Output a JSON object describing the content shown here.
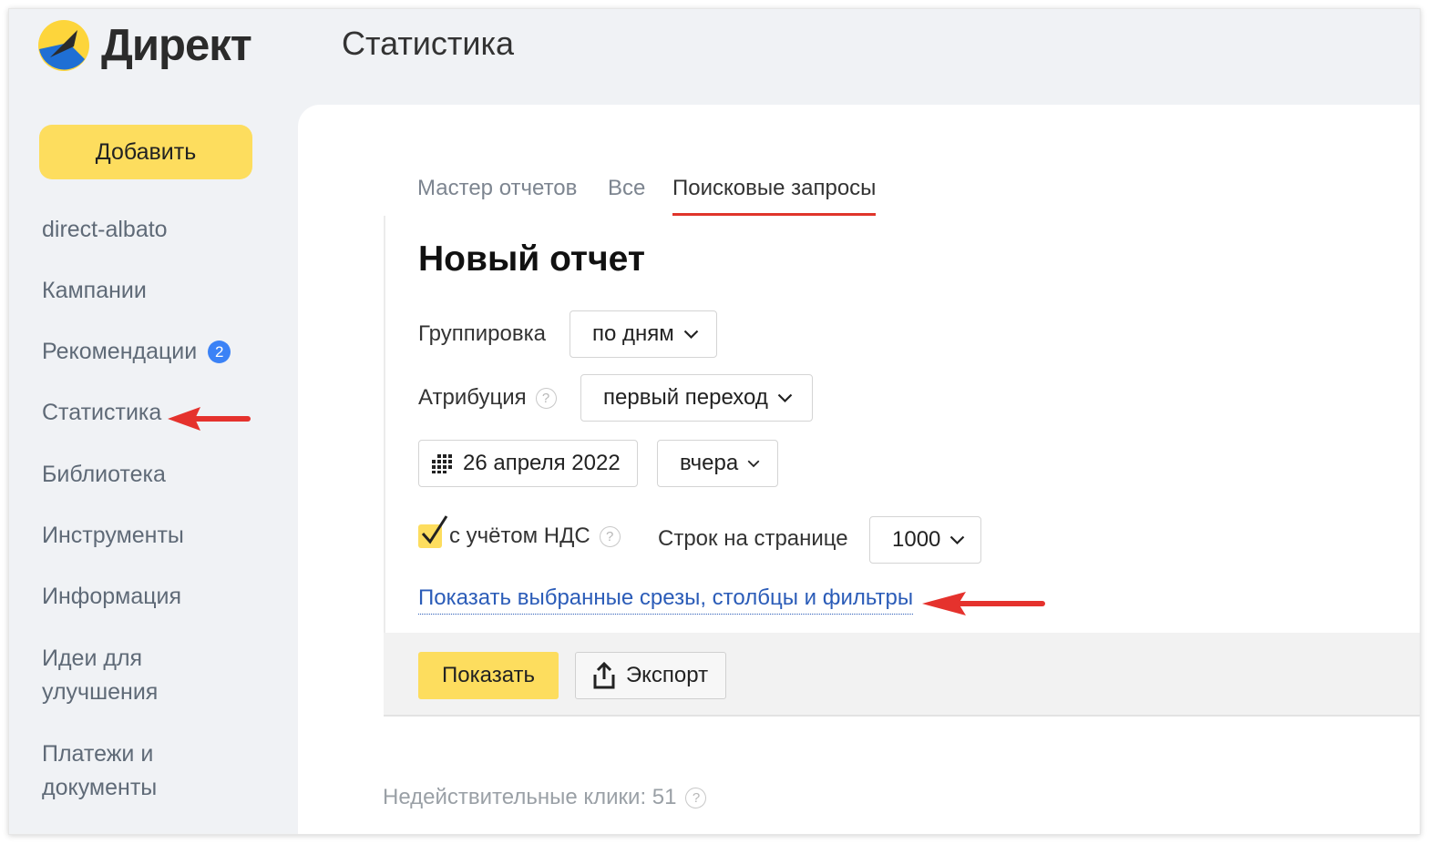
{
  "header": {
    "logo_text": "Директ",
    "page_title": "Статистика"
  },
  "sidebar": {
    "add_button": "Добавить",
    "items": [
      {
        "label": "direct-albato"
      },
      {
        "label": "Кампании"
      },
      {
        "label": "Рекомендации",
        "badge": "2"
      },
      {
        "label": "Статистика"
      },
      {
        "label": "Библиотека"
      },
      {
        "label": "Инструменты"
      },
      {
        "label": "Информация"
      },
      {
        "label": "Идеи для",
        "label2": "улучшения"
      },
      {
        "label": "Платежи и",
        "label2": "документы"
      }
    ]
  },
  "tabs": [
    {
      "label": "Мастер отчетов"
    },
    {
      "label": "Все"
    },
    {
      "label": "Поисковые запросы",
      "active": true
    }
  ],
  "report": {
    "title": "Новый отчет",
    "grouping_label": "Группировка",
    "grouping_value": "по дням",
    "attribution_label": "Атрибуция",
    "attribution_value": "первый переход",
    "date_value": "26 апреля 2022",
    "period_value": "вчера",
    "vat_label": "с учётом НДС",
    "vat_checked": true,
    "rows_label": "Строк на странице",
    "rows_value": "1000",
    "show_link": "Показать выбранные срезы, столбцы и фильтры"
  },
  "actions": {
    "show_button": "Показать",
    "export_button": "Экспорт"
  },
  "footer": {
    "invalid_clicks": "Недействительные клики: 51"
  },
  "colors": {
    "accent_yellow": "#fddd5e",
    "link_blue": "#2b5cb8",
    "tab_underline": "#e0352b",
    "badge_blue": "#3b82f6",
    "arrow_red": "#e5322d"
  },
  "icons": {
    "help": "?"
  }
}
